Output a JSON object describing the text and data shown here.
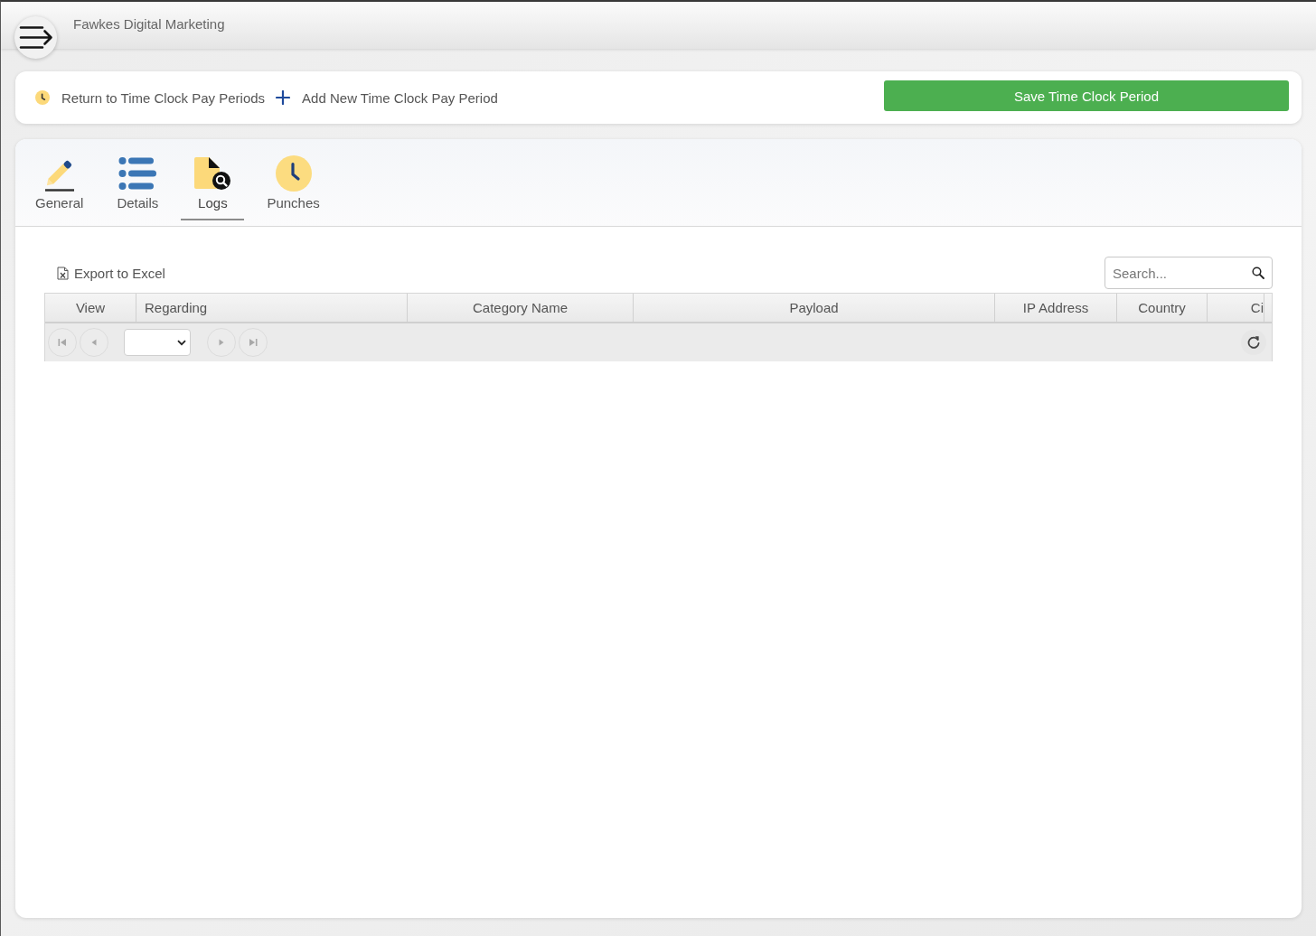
{
  "header": {
    "title": "Fawkes Digital Marketing"
  },
  "actions": {
    "links": [
      {
        "kind": "back",
        "label": "Return to Time Clock Pay Periods"
      },
      {
        "kind": "add",
        "label": "Add New Time Clock Pay Period"
      }
    ],
    "save_button": "Save Time Clock Period"
  },
  "tabs": [
    {
      "kind": "general",
      "label": "General",
      "selected": false
    },
    {
      "kind": "details",
      "label": "Details",
      "selected": false
    },
    {
      "kind": "logs",
      "label": "Logs",
      "selected": true
    },
    {
      "kind": "punches",
      "label": "Punches",
      "selected": false
    }
  ],
  "toolbar": {
    "export": "Export to Excel",
    "search": {
      "placeholder": "Search..."
    }
  },
  "table": {
    "columns": [
      "View",
      "Regarding",
      "Category Name",
      "Payload",
      "IP Address",
      "Country",
      "Ci"
    ]
  },
  "pager": {
    "buttons": [
      {
        "kind": "first",
        "disabled": true
      },
      {
        "kind": "prev",
        "disabled": true
      },
      {
        "kind": "next",
        "disabled": true
      },
      {
        "kind": "last",
        "disabled": true
      }
    ]
  }
}
